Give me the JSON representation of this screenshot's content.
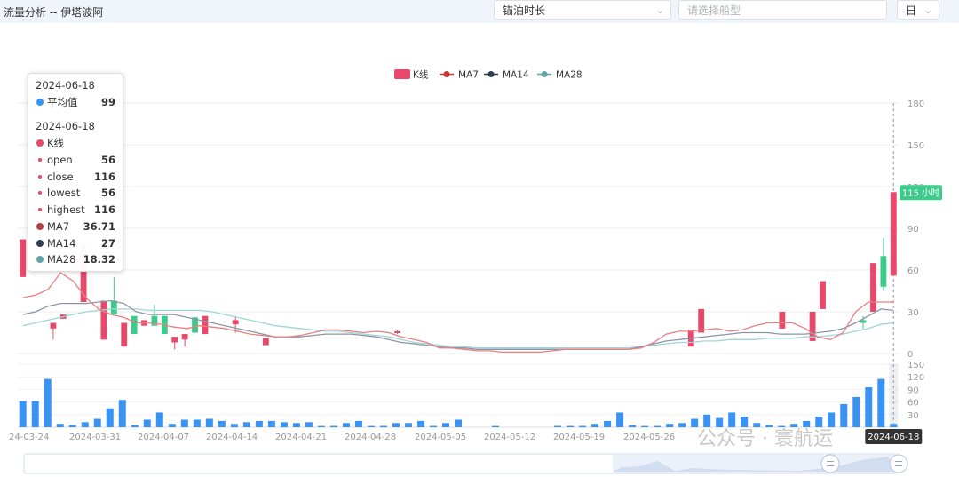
{
  "header": {
    "title": "流量分析 -- 伊塔波阿",
    "metric_select": "锚泊时长",
    "ship_type_placeholder": "请选择船型",
    "period_select": "日"
  },
  "colors": {
    "up": "#e8486a",
    "down": "#3dcb8c",
    "ma7": "#e88080",
    "ma14": "#8c95a8",
    "ma28": "#9fd5d6",
    "volume": "#3a93f3",
    "label_badge": "#3dcb8c"
  },
  "chart_data": {
    "type": "candlestick",
    "legend": [
      "K线",
      "MA7",
      "MA14",
      "MA28"
    ],
    "legend_position": "top-center",
    "y_axis": {
      "ticks": [
        "180",
        "150",
        "120",
        "90",
        "60",
        "30",
        "0"
      ],
      "min": 0,
      "max": 180,
      "position": "right"
    },
    "volume_axis": {
      "ticks": [
        "150",
        "120",
        "90",
        "60",
        "30"
      ],
      "min": 0,
      "max": 150,
      "position": "right"
    },
    "x_tick_labels": [
      "24-03-24",
      "2024-03-31",
      "2024-04-07",
      "2024-04-14",
      "2024-04-21",
      "2024-04-28",
      "2024-05-05",
      "2024-05-12",
      "2024-05-19",
      "2024-05-26",
      "2024-06-18"
    ],
    "current_value_label": "115 小时",
    "crosshair_date_label": "2024-06-18",
    "candles": [
      {
        "date": "2024-03-24",
        "open": 55,
        "close": 82,
        "low": 55,
        "high": 82
      },
      {
        "date": "2024-03-27",
        "open": 18,
        "close": 22,
        "low": 10,
        "high": 22
      },
      {
        "date": "2024-03-28",
        "open": 25,
        "close": 28,
        "low": 25,
        "high": 28
      },
      {
        "date": "2024-03-30",
        "open": 37,
        "close": 78,
        "low": 37,
        "high": 78
      },
      {
        "date": "2024-04-01",
        "open": 10,
        "close": 38,
        "low": 10,
        "high": 38
      },
      {
        "date": "2024-04-02",
        "open": 38,
        "close": 28,
        "low": 28,
        "high": 55
      },
      {
        "date": "2024-04-03",
        "open": 5,
        "close": 22,
        "low": 5,
        "high": 22
      },
      {
        "date": "2024-04-04",
        "open": 27,
        "close": 14,
        "low": 14,
        "high": 27
      },
      {
        "date": "2024-04-05",
        "open": 20,
        "close": 24,
        "low": 20,
        "high": 24
      },
      {
        "date": "2024-04-06",
        "open": 27,
        "close": 20,
        "low": 20,
        "high": 35
      },
      {
        "date": "2024-04-07",
        "open": 27,
        "close": 14,
        "low": 14,
        "high": 27
      },
      {
        "date": "2024-04-08",
        "open": 8,
        "close": 12,
        "low": 3,
        "high": 12
      },
      {
        "date": "2024-04-09",
        "open": 10,
        "close": 14,
        "low": 5,
        "high": 14
      },
      {
        "date": "2024-04-10",
        "open": 26,
        "close": 15,
        "low": 15,
        "high": 26
      },
      {
        "date": "2024-04-11",
        "open": 14,
        "close": 27,
        "low": 14,
        "high": 27
      },
      {
        "date": "2024-04-14",
        "open": 21,
        "close": 24,
        "low": 15,
        "high": 27
      },
      {
        "date": "2024-04-17",
        "open": 6,
        "close": 11,
        "low": 6,
        "high": 11
      },
      {
        "date": "2024-04-30",
        "open": 15,
        "close": 16,
        "low": 14,
        "high": 17
      },
      {
        "date": "2024-05-29",
        "open": 5,
        "close": 17,
        "low": 5,
        "high": 17
      },
      {
        "date": "2024-05-30",
        "open": 15,
        "close": 32,
        "low": 15,
        "high": 32
      },
      {
        "date": "2024-06-07",
        "open": 18,
        "close": 30,
        "low": 18,
        "high": 30
      },
      {
        "date": "2024-06-10",
        "open": 9,
        "close": 30,
        "low": 9,
        "high": 30
      },
      {
        "date": "2024-06-11",
        "open": 32,
        "close": 52,
        "low": 32,
        "high": 52
      },
      {
        "date": "2024-06-15",
        "open": 24,
        "close": 22,
        "low": 18,
        "high": 27
      },
      {
        "date": "2024-06-16",
        "open": 30,
        "close": 65,
        "low": 30,
        "high": 65
      },
      {
        "date": "2024-06-17",
        "open": 70,
        "close": 48,
        "low": 45,
        "high": 83
      },
      {
        "date": "2024-06-18",
        "open": 56,
        "close": 116,
        "low": 56,
        "high": 116
      }
    ],
    "ma7": [
      [
        0,
        40
      ],
      [
        1,
        42
      ],
      [
        2,
        46
      ],
      [
        3,
        58
      ],
      [
        4,
        52
      ],
      [
        5,
        40
      ],
      [
        6,
        32
      ],
      [
        7,
        28
      ],
      [
        8,
        26
      ],
      [
        9,
        22
      ],
      [
        10,
        22
      ],
      [
        11,
        21
      ],
      [
        12,
        19
      ],
      [
        13,
        18
      ],
      [
        14,
        20
      ],
      [
        15,
        19
      ],
      [
        16,
        18
      ],
      [
        17,
        16
      ],
      [
        18,
        14
      ],
      [
        19,
        13
      ],
      [
        20,
        12
      ],
      [
        21,
        12
      ],
      [
        22,
        13
      ],
      [
        23,
        15
      ],
      [
        24,
        17
      ],
      [
        25,
        17
      ],
      [
        26,
        16
      ],
      [
        27,
        15
      ],
      [
        28,
        16
      ],
      [
        29,
        15
      ],
      [
        30,
        12
      ],
      [
        31,
        10
      ],
      [
        32,
        8
      ],
      [
        33,
        4
      ],
      [
        34,
        4
      ],
      [
        35,
        3
      ],
      [
        36,
        2
      ],
      [
        37,
        2
      ],
      [
        38,
        1
      ],
      [
        39,
        1
      ],
      [
        40,
        1
      ],
      [
        41,
        1
      ],
      [
        42,
        2
      ],
      [
        43,
        3
      ],
      [
        44,
        3
      ],
      [
        45,
        3
      ],
      [
        46,
        3
      ],
      [
        47,
        3
      ],
      [
        48,
        3
      ],
      [
        49,
        4
      ],
      [
        50,
        8
      ],
      [
        51,
        14
      ],
      [
        52,
        16
      ],
      [
        53,
        16
      ],
      [
        54,
        17
      ],
      [
        55,
        18
      ],
      [
        56,
        16
      ],
      [
        57,
        17
      ],
      [
        58,
        20
      ],
      [
        59,
        22
      ],
      [
        60,
        22
      ],
      [
        61,
        22
      ],
      [
        62,
        18
      ],
      [
        63,
        12
      ],
      [
        64,
        10
      ],
      [
        65,
        15
      ],
      [
        66,
        30
      ],
      [
        67,
        37
      ],
      [
        68,
        37
      ],
      [
        69,
        37
      ]
    ],
    "ma14": [
      [
        0,
        28
      ],
      [
        1,
        30
      ],
      [
        2,
        34
      ],
      [
        3,
        36
      ],
      [
        4,
        36
      ],
      [
        5,
        36
      ],
      [
        6,
        37
      ],
      [
        7,
        38
      ],
      [
        8,
        36
      ],
      [
        9,
        30
      ],
      [
        10,
        28
      ],
      [
        11,
        28
      ],
      [
        12,
        28
      ],
      [
        13,
        26
      ],
      [
        14,
        24
      ],
      [
        15,
        22
      ],
      [
        16,
        20
      ],
      [
        17,
        18
      ],
      [
        18,
        16
      ],
      [
        19,
        14
      ],
      [
        20,
        12
      ],
      [
        21,
        12
      ],
      [
        22,
        12
      ],
      [
        23,
        13
      ],
      [
        24,
        14
      ],
      [
        25,
        14
      ],
      [
        26,
        14
      ],
      [
        27,
        13
      ],
      [
        28,
        12
      ],
      [
        29,
        10
      ],
      [
        30,
        8
      ],
      [
        31,
        7
      ],
      [
        32,
        6
      ],
      [
        33,
        5
      ],
      [
        34,
        4
      ],
      [
        35,
        4
      ],
      [
        36,
        3
      ],
      [
        37,
        3
      ],
      [
        38,
        3
      ],
      [
        39,
        3
      ],
      [
        40,
        3
      ],
      [
        41,
        3
      ],
      [
        42,
        3
      ],
      [
        43,
        3
      ],
      [
        44,
        3
      ],
      [
        45,
        3
      ],
      [
        46,
        3
      ],
      [
        47,
        3
      ],
      [
        48,
        3
      ],
      [
        49,
        5
      ],
      [
        50,
        7
      ],
      [
        51,
        9
      ],
      [
        52,
        10
      ],
      [
        53,
        11
      ],
      [
        54,
        12
      ],
      [
        55,
        13
      ],
      [
        56,
        14
      ],
      [
        57,
        15
      ],
      [
        58,
        15
      ],
      [
        59,
        15
      ],
      [
        60,
        14
      ],
      [
        61,
        14
      ],
      [
        62,
        14
      ],
      [
        63,
        15
      ],
      [
        64,
        16
      ],
      [
        65,
        18
      ],
      [
        66,
        22
      ],
      [
        67,
        27
      ],
      [
        68,
        32
      ],
      [
        69,
        31
      ]
    ],
    "ma28": [
      [
        0,
        20
      ],
      [
        1,
        22
      ],
      [
        2,
        24
      ],
      [
        3,
        26
      ],
      [
        4,
        28
      ],
      [
        5,
        30
      ],
      [
        6,
        31
      ],
      [
        7,
        32
      ],
      [
        8,
        32
      ],
      [
        9,
        32
      ],
      [
        10,
        31
      ],
      [
        11,
        31
      ],
      [
        12,
        31
      ],
      [
        13,
        31
      ],
      [
        14,
        31
      ],
      [
        15,
        30
      ],
      [
        16,
        28
      ],
      [
        17,
        26
      ],
      [
        18,
        24
      ],
      [
        19,
        22
      ],
      [
        20,
        20
      ],
      [
        21,
        19
      ],
      [
        22,
        18
      ],
      [
        23,
        17
      ],
      [
        24,
        16
      ],
      [
        25,
        16
      ],
      [
        26,
        15
      ],
      [
        27,
        14
      ],
      [
        28,
        13
      ],
      [
        29,
        12
      ],
      [
        30,
        10
      ],
      [
        31,
        8
      ],
      [
        32,
        7
      ],
      [
        33,
        6
      ],
      [
        34,
        5
      ],
      [
        35,
        5
      ],
      [
        36,
        4
      ],
      [
        37,
        4
      ],
      [
        38,
        4
      ],
      [
        39,
        4
      ],
      [
        40,
        4
      ],
      [
        41,
        4
      ],
      [
        42,
        4
      ],
      [
        43,
        4
      ],
      [
        44,
        4
      ],
      [
        45,
        4
      ],
      [
        46,
        4
      ],
      [
        47,
        4
      ],
      [
        48,
        4
      ],
      [
        49,
        5
      ],
      [
        50,
        6
      ],
      [
        51,
        7
      ],
      [
        52,
        8
      ],
      [
        53,
        8
      ],
      [
        54,
        9
      ],
      [
        55,
        9
      ],
      [
        56,
        10
      ],
      [
        57,
        10
      ],
      [
        58,
        10
      ],
      [
        59,
        11
      ],
      [
        60,
        11
      ],
      [
        61,
        11
      ],
      [
        62,
        12
      ],
      [
        63,
        12
      ],
      [
        64,
        13
      ],
      [
        65,
        14
      ],
      [
        66,
        16
      ],
      [
        67,
        18
      ],
      [
        68,
        21
      ],
      [
        69,
        22
      ]
    ],
    "volume": [
      [
        0,
        62
      ],
      [
        1,
        62
      ],
      [
        2,
        115
      ],
      [
        3,
        8
      ],
      [
        4,
        5
      ],
      [
        5,
        12
      ],
      [
        6,
        20
      ],
      [
        7,
        45
      ],
      [
        8,
        65
      ],
      [
        9,
        5
      ],
      [
        10,
        18
      ],
      [
        11,
        35
      ],
      [
        12,
        8
      ],
      [
        13,
        18
      ],
      [
        14,
        18
      ],
      [
        15,
        20
      ],
      [
        16,
        15
      ],
      [
        17,
        8
      ],
      [
        18,
        12
      ],
      [
        19,
        15
      ],
      [
        20,
        15
      ],
      [
        21,
        12
      ],
      [
        22,
        10
      ],
      [
        23,
        12
      ],
      [
        24,
        3
      ],
      [
        25,
        3
      ],
      [
        26,
        10
      ],
      [
        27,
        15
      ],
      [
        28,
        3
      ],
      [
        29,
        3
      ],
      [
        30,
        10
      ],
      [
        31,
        10
      ],
      [
        32,
        15
      ],
      [
        33,
        3
      ],
      [
        34,
        10
      ],
      [
        35,
        18
      ],
      [
        36,
        0
      ],
      [
        37,
        0
      ],
      [
        38,
        3
      ],
      [
        39,
        0
      ],
      [
        40,
        0
      ],
      [
        41,
        0
      ],
      [
        42,
        0
      ],
      [
        43,
        3
      ],
      [
        44,
        3
      ],
      [
        45,
        3
      ],
      [
        46,
        8
      ],
      [
        47,
        15
      ],
      [
        48,
        35
      ],
      [
        49,
        5
      ],
      [
        50,
        3
      ],
      [
        51,
        3
      ],
      [
        52,
        8
      ],
      [
        53,
        10
      ],
      [
        54,
        20
      ],
      [
        55,
        30
      ],
      [
        56,
        22
      ],
      [
        57,
        35
      ],
      [
        58,
        25
      ],
      [
        59,
        10
      ],
      [
        60,
        5
      ],
      [
        61,
        3
      ],
      [
        62,
        8
      ],
      [
        63,
        15
      ],
      [
        64,
        25
      ],
      [
        65,
        35
      ],
      [
        66,
        55
      ],
      [
        67,
        72
      ],
      [
        68,
        95
      ],
      [
        69,
        115
      ],
      [
        70,
        8
      ]
    ],
    "tooltip": {
      "volume_date": "2024-06-18",
      "volume_label": "平均值",
      "volume_value": "99",
      "k_date": "2024-06-18",
      "k_label": "K线",
      "open_label": "open",
      "open_value": "56",
      "close_label": "close",
      "close_value": "116",
      "lowest_label": "lowest",
      "lowest_value": "56",
      "highest_label": "highest",
      "highest_value": "116",
      "ma7_label": "MA7",
      "ma7_value": "36.71",
      "ma14_label": "MA14",
      "ma14_value": "27",
      "ma28_label": "MA28",
      "ma28_value": "18.32"
    }
  },
  "watermark": "公众号 · 寰航运"
}
